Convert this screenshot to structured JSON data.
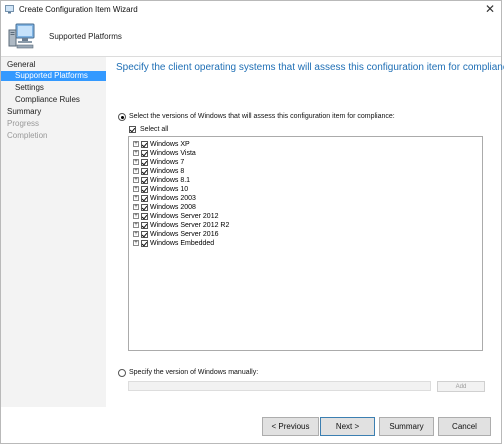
{
  "window": {
    "title": "Create Configuration Item Wizard",
    "close_glyph": "✕"
  },
  "header": {
    "subtitle": "Supported Platforms",
    "icon": "computer-monitor-icon"
  },
  "nav": {
    "items": [
      {
        "label": "General",
        "state": "normal"
      },
      {
        "label": "Supported Platforms",
        "state": "selected"
      },
      {
        "label": "Settings",
        "state": "normal"
      },
      {
        "label": "Compliance Rules",
        "state": "normal"
      },
      {
        "label": "Summary",
        "state": "normal"
      },
      {
        "label": "Progress",
        "state": "disabled"
      },
      {
        "label": "Completion",
        "state": "disabled"
      }
    ]
  },
  "main": {
    "heading": "Specify the client operating systems that will assess this configuration item for compliance",
    "radio_select_versions": "Select the versions of Windows that will assess this configuration item for compliance:",
    "select_all": "Select all",
    "tree_items": [
      "Windows XP",
      "Windows Vista",
      "Windows 7",
      "Windows 8",
      "Windows 8.1",
      "Windows 10",
      "Windows 2003",
      "Windows 2008",
      "Windows Server 2012",
      "Windows Server 2012 R2",
      "Windows Server 2016",
      "Windows Embedded"
    ],
    "radio_manual": "Specify the version of Windows manually:",
    "add_label": "Add"
  },
  "footer": {
    "previous": "< Previous",
    "next": "Next >",
    "summary": "Summary",
    "cancel": "Cancel"
  },
  "colors": {
    "accent": "#3399ff",
    "heading": "#1f6fb5",
    "nav_bg": "#f3f3f3"
  }
}
